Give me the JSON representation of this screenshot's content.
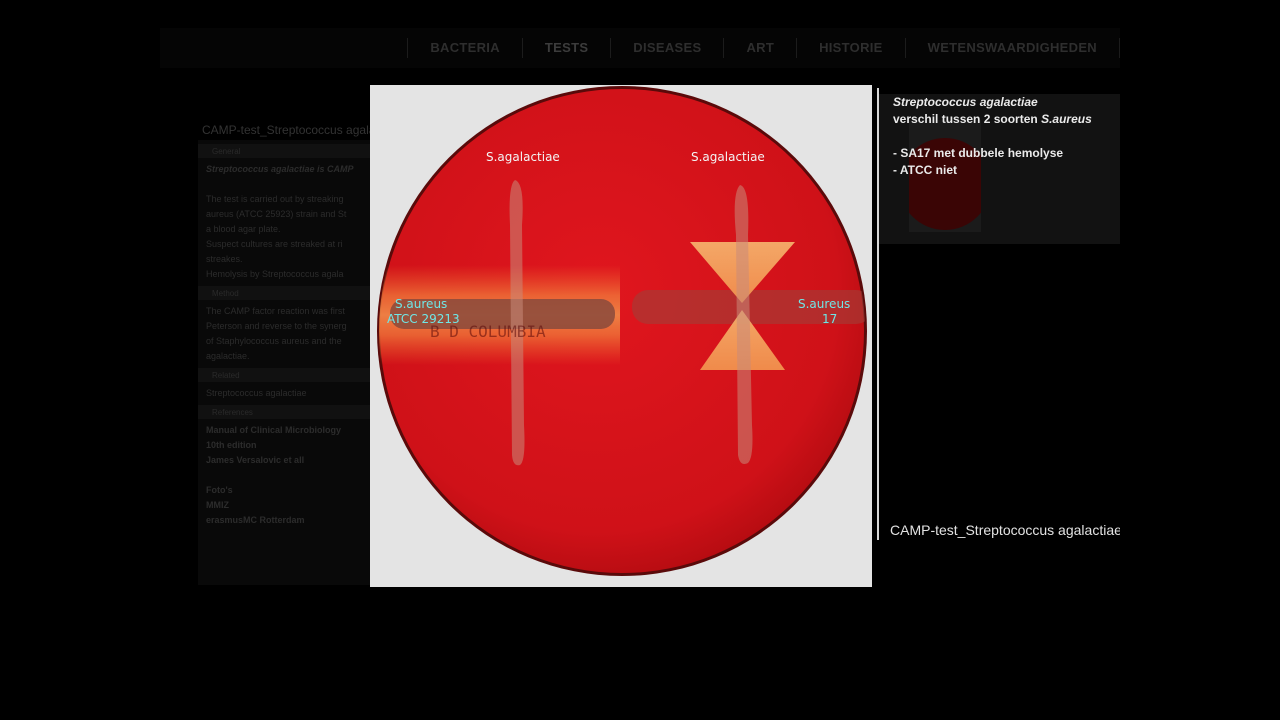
{
  "nav": {
    "items": [
      "BACTERIA",
      "TESTS",
      "DISEASES",
      "ART",
      "HISTORIE",
      "WETENSWAARDIGHEDEN"
    ],
    "active": "TESTS"
  },
  "background": {
    "page_title": "CAMP-test_Streptococcus agalactiae",
    "section_headers": [
      "General",
      "Method",
      "Related",
      "References"
    ],
    "lines": [
      "Streptococcus agalactiae is CAMP",
      "The test is carried out by streaking",
      "aureus (ATCC 25923) strain and St",
      "a blood agar plate.",
      "Suspect cultures are streaked at ri",
      "streakes.",
      "Hemolysis by Streptococcus agala",
      "The CAMP factor reaction was first",
      "Peterson and reverse to the synerg",
      "of Staphylococcus aureus and the",
      "agalactiae.",
      "Streptococcus agalactiae"
    ],
    "refs": [
      "Manual of Clinical Microbiology",
      "10th edition",
      "James Versalovic et all",
      "Foto's",
      "MMIZ",
      "erasmusMC Rotterdam"
    ]
  },
  "image": {
    "labels": {
      "top_left": "S.agalactiae",
      "top_right": "S.agalactiae",
      "left_line1": "S.aureus",
      "left_line2": "ATCC 29213",
      "right_line1": "S.aureus",
      "right_line2": "17"
    },
    "plate_print": "B D COLUMBIA"
  },
  "caption": {
    "species": "Streptococcus agalactiae",
    "line2_prefix": "verschil tussen 2 soorten ",
    "line2_species": "S.aureus",
    "bullets": [
      "- SA17 met dubbele hemolyse",
      "- ATCC niet"
    ]
  },
  "download": {
    "icon": "cloud-download-icon",
    "filename": "CAMP-test_Streptococcus agalactiae"
  },
  "colors": {
    "agar": "#d0131a",
    "label_white": "#f4f4f4",
    "label_cyan": "#6fe6e6"
  }
}
